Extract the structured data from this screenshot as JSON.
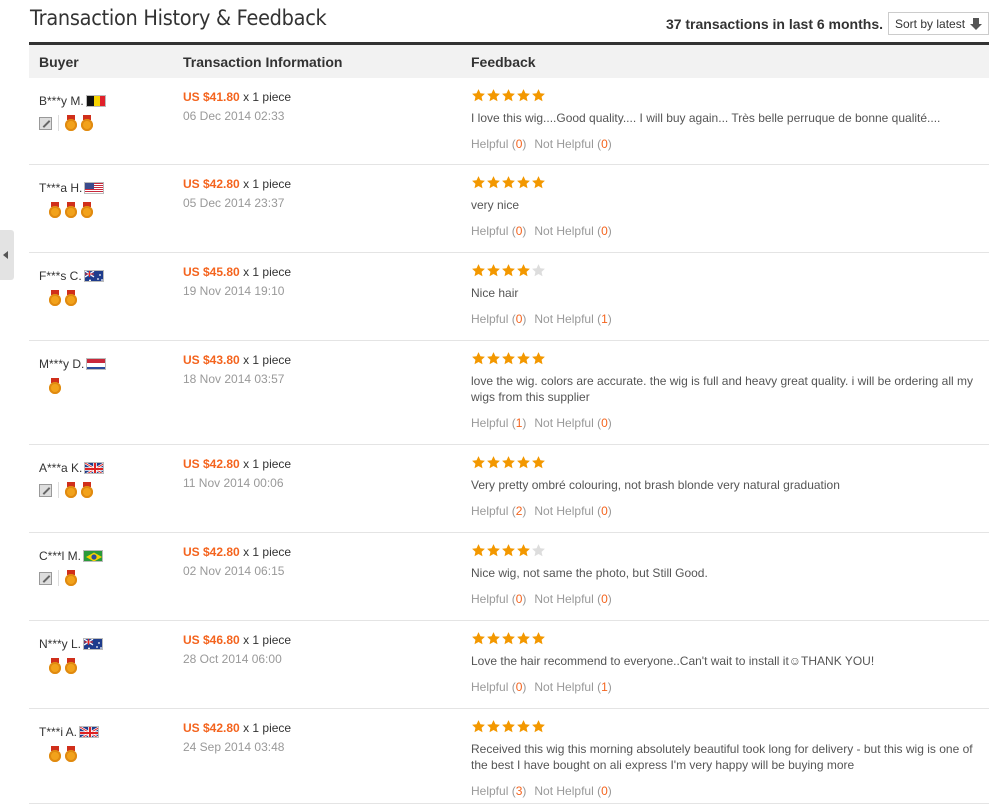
{
  "header": {
    "title": "Transaction History & Feedback",
    "summary": "37 transactions in last 6 months.",
    "sort_label": "Sort by latest"
  },
  "columns": {
    "buyer": "Buyer",
    "transaction": "Transaction Information",
    "feedback": "Feedback"
  },
  "colors": {
    "accent": "#f4641e",
    "star": "#f39800",
    "star_empty": "#dddddd"
  },
  "rows": [
    {
      "buyer": "B***y M.",
      "flag": "be-flag",
      "has_pen": true,
      "medals": 2,
      "price": "US $41.80",
      "qty": "x 1 piece",
      "date": "06 Dec 2014 02:33",
      "stars": 5,
      "comment": "I love this wig....Good quality.... I will buy again... Très belle perruque de bonne qualité....",
      "helpful_label": "Helpful (",
      "helpful": "0",
      "not_helpful_label": "Not Helpful (",
      "not_helpful": "0",
      "close": ")"
    },
    {
      "buyer": "T***a H.",
      "flag": "us-flag",
      "has_pen": false,
      "medals": 3,
      "price": "US $42.80",
      "qty": "x 1 piece",
      "date": "05 Dec 2014 23:37",
      "stars": 5,
      "comment": "very nice",
      "helpful_label": "Helpful (",
      "helpful": "0",
      "not_helpful_label": "Not Helpful (",
      "not_helpful": "0",
      "close": ")"
    },
    {
      "buyer": "F***s C.",
      "flag": "au-flag",
      "has_pen": false,
      "medals": 2,
      "price": "US $45.80",
      "qty": "x 1 piece",
      "date": "19 Nov 2014 19:10",
      "stars": 4,
      "comment": "Nice hair",
      "helpful_label": "Helpful (",
      "helpful": "0",
      "not_helpful_label": "Not Helpful (",
      "not_helpful": "1",
      "close": ")"
    },
    {
      "buyer": "M***y D.",
      "flag": "nl-flag",
      "has_pen": false,
      "medals": 1,
      "price": "US $43.80",
      "qty": "x 1 piece",
      "date": "18 Nov 2014 03:57",
      "stars": 5,
      "comment": "love the wig. colors are accurate. the wig is full and heavy great quality. i will be ordering all my wigs from this supplier",
      "helpful_label": "Helpful (",
      "helpful": "1",
      "not_helpful_label": "Not Helpful (",
      "not_helpful": "0",
      "close": ")"
    },
    {
      "buyer": "A***a K.",
      "flag": "uk-flag",
      "has_pen": true,
      "medals": 2,
      "price": "US $42.80",
      "qty": "x 1 piece",
      "date": "11 Nov 2014 00:06",
      "stars": 5,
      "comment": "Very pretty ombré colouring, not brash blonde very natural graduation",
      "helpful_label": "Helpful (",
      "helpful": "2",
      "not_helpful_label": "Not Helpful (",
      "not_helpful": "0",
      "close": ")"
    },
    {
      "buyer": "C***l M.",
      "flag": "br-flag",
      "has_pen": true,
      "medals": 1,
      "price": "US $42.80",
      "qty": "x 1 piece",
      "date": "02 Nov 2014 06:15",
      "stars": 4,
      "comment": "Nice wig, not same the photo, but Still Good.",
      "helpful_label": "Helpful (",
      "helpful": "0",
      "not_helpful_label": "Not Helpful (",
      "not_helpful": "0",
      "close": ")"
    },
    {
      "buyer": "N***y L.",
      "flag": "au-flag",
      "has_pen": false,
      "medals": 2,
      "price": "US $46.80",
      "qty": "x 1 piece",
      "date": "28 Oct 2014 06:00",
      "stars": 5,
      "comment": "Love the hair recommend to everyone..Can't wait to install it☺THANK YOU!",
      "helpful_label": "Helpful (",
      "helpful": "0",
      "not_helpful_label": "Not Helpful (",
      "not_helpful": "1",
      "close": ")"
    },
    {
      "buyer": "T***i A.",
      "flag": "uk-flag",
      "has_pen": false,
      "medals": 2,
      "price": "US $42.80",
      "qty": "x 1 piece",
      "date": "24 Sep 2014 03:48",
      "stars": 5,
      "comment": "Received this wig this morning absolutely beautiful took long for delivery - but this wig is one of the best I have bought on ali express I'm very happy will be buying more",
      "helpful_label": "Helpful (",
      "helpful": "3",
      "not_helpful_label": "Not Helpful (",
      "not_helpful": "0",
      "close": ")"
    }
  ]
}
